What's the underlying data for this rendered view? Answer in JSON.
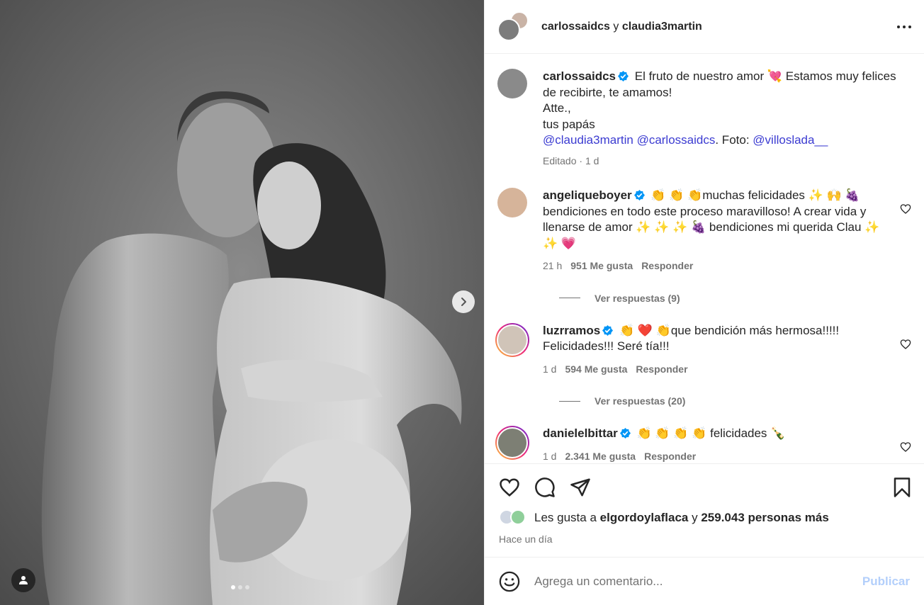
{
  "header": {
    "user1": "carlossaidcs",
    "conjunction": "y",
    "user2": "claudia3martin"
  },
  "caption": {
    "username": "carlossaidcs",
    "text1": "El fruto de nuestro amor 💘 Estamos muy felices de recibirte, te amamos!",
    "text2": "Atte.,",
    "text3": "tus papás",
    "mention1": "@claudia3martin",
    "mention2": "@carlossaidcs",
    "foto_label": ". Foto: ",
    "mention3": "@villoslada__",
    "edited": "Editado",
    "sep": " · ",
    "time": "1 d"
  },
  "comments": [
    {
      "username": "angeliqueboyer",
      "text": "👏 👏 👏muchas felicidades ✨ 🙌 🍇 bendiciones en todo este proceso maravilloso! A crear vida y llenarse de amor ✨ ✨ ✨ 🍇  bendiciones mi querida Clau ✨ ✨ 💗",
      "time": "21 h",
      "likes": "951 Me gusta",
      "reply": "Responder",
      "view_replies": "Ver respuestas (9)"
    },
    {
      "username": "luzrramos",
      "text": "👏 ❤️ 👏que bendición más hermosa!!!!! Felicidades!!! Seré tía!!!",
      "time": "1 d",
      "likes": "594 Me gusta",
      "reply": "Responder",
      "view_replies": "Ver respuestas (20)"
    },
    {
      "username": "danielelbittar",
      "text": "👏 👏 👏 👏  felicidades 🍾",
      "time": "1 d",
      "likes": "2.341 Me gusta",
      "reply": "Responder"
    }
  ],
  "likes_line": {
    "prefix": "Les gusta a",
    "user": "elgordoylaflaca",
    "middle": "y",
    "count": "259.043 personas más"
  },
  "posted": "Hace un día",
  "add_comment": {
    "placeholder": "Agrega un comentario...",
    "post_label": "Publicar"
  },
  "colors": {
    "verified": "#0095f6",
    "mention": "#3b3bd1",
    "post_disabled": "#b3cffb"
  },
  "icons": [
    "chevron-right-icon",
    "user-tag-icon",
    "more-icon",
    "verified-badge-icon",
    "heart-icon",
    "comment-icon",
    "share-icon",
    "bookmark-icon",
    "emoji-icon"
  ],
  "carousel": {
    "slide": 1,
    "total": 3
  }
}
